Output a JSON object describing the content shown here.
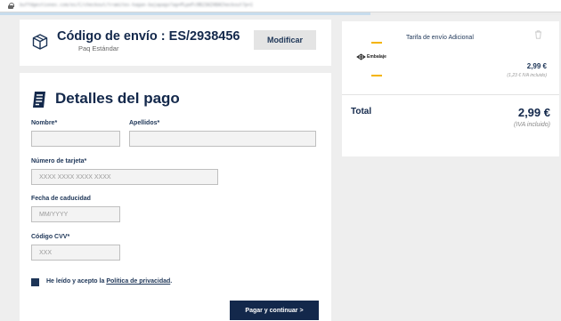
{
  "browser": {
    "url": "buffdgestiones.com/es/C/checkout/tramites-hagan-bajapago?ag=PLpeFc9B23AZ48ACheckout?p=1"
  },
  "shipping": {
    "code_text": "Código de envío : ES/2938456",
    "type": "Paq Estándar",
    "modify_label": "Modificar"
  },
  "payment": {
    "title": "Detalles del pago",
    "fields": {
      "first_name_label": "Nombre*",
      "last_name_label": "Apellidos*",
      "card_number_label": "Número de tarjeta*",
      "card_number_placeholder": "XXXX XXXX XXXX XXXX",
      "expiry_label": "Fecha de caducidad",
      "expiry_placeholder": "MM/YYYY",
      "cvv_label": "Código CVV*",
      "cvv_placeholder": "XXX"
    },
    "consent_prefix": "He leído y acepto la ",
    "consent_link": "Política de privacidad",
    "consent_suffix": ".",
    "submit_label": "Pagar y continuar >"
  },
  "summary": {
    "logo_text": "Embalaje",
    "item_name": "Tarifa de envío Adicional",
    "item_price": "2,99 €",
    "item_vat_note": "(1,23 € IVA incluido)",
    "total_label": "Total",
    "total_value": "2,99 €",
    "total_vat": "(IVA incluido)"
  },
  "progress": {
    "fraction": 0.66
  },
  "icons": {
    "shipping": "package-box-icon",
    "payment": "receipt-icon",
    "delete": "trash-icon",
    "lock": "lock-icon"
  },
  "colors": {
    "primary": "#13284b",
    "accent": "#f4b400",
    "page_bg": "#eeeeee"
  }
}
